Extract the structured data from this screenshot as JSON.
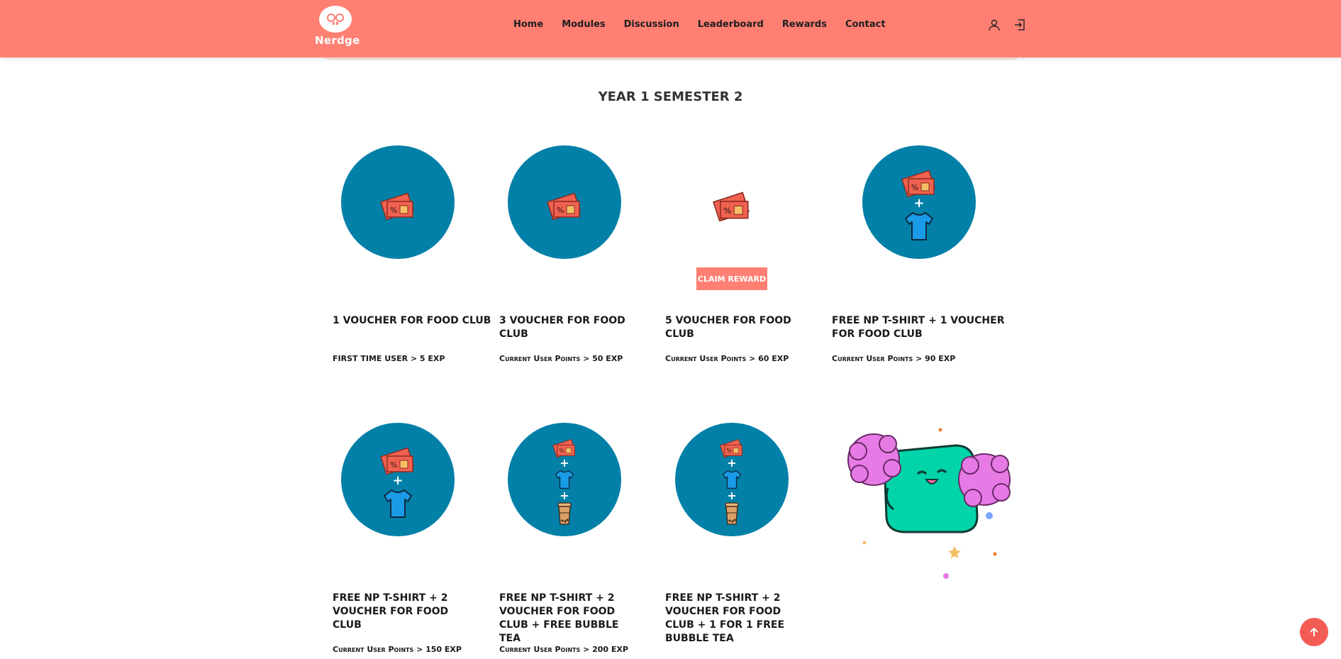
{
  "brand": {
    "name": "Nerdge",
    "accent": "#ff7f73"
  },
  "nav": {
    "links": [
      "Home",
      "Modules",
      "Discussion",
      "Leaderboard",
      "Rewards",
      "Contact"
    ],
    "icons": [
      "user-icon",
      "logout-icon"
    ]
  },
  "section": {
    "title": "YEAR 1 SEMESTER 2"
  },
  "rewards": [
    {
      "title": "1 VOUCHER FOR FOOD CLUB",
      "requirement": "FIRST TIME USER > 5 EXP",
      "items": [
        "voucher"
      ]
    },
    {
      "title": "3 VOUCHER FOR FOOD CLUB",
      "requirement": "Current User Points > 50 EXP",
      "items": [
        "voucher"
      ]
    },
    {
      "title": "5 VOUCHER FOR FOOD CLUB",
      "requirement": "Current User Points > 60 EXP",
      "items": [
        "voucher"
      ],
      "claimable": true
    },
    {
      "title": "FREE NP T-SHIRT + 1 VOUCHER FOR FOOD CLUB",
      "requirement": "Current User Points > 90 EXP",
      "items": [
        "voucher",
        "tshirt"
      ]
    },
    {
      "title": "FREE NP T-SHIRT + 2 VOUCHER FOR FOOD CLUB",
      "requirement": "Current User Points > 150 EXP",
      "items": [
        "voucher",
        "tshirt"
      ]
    },
    {
      "title": "FREE NP T-SHIRT + 2 VOUCHER FOR FOOD CLUB + FREE BUBBLE TEA",
      "requirement": "Current User Points > 200 EXP",
      "items": [
        "voucher",
        "tshirt",
        "bubble-tea"
      ]
    },
    {
      "title": "FREE NP T-SHIRT + 2 VOUCHER FOR FOOD CLUB + 1 FOR 1 FREE BUBBLE TEA",
      "requirement": "",
      "items": [
        "voucher",
        "tshirt",
        "bubble-tea"
      ]
    }
  ],
  "plus_sign": "+",
  "claim_button": {
    "label": "CLAIM REWARD"
  },
  "colors": {
    "circle": "#0380a8",
    "voucher": "#f0614f",
    "tshirt": "#1a9be8",
    "navbar": "#ff7f73",
    "mascot": "#00d4a8",
    "pompom": "#e77be6"
  }
}
